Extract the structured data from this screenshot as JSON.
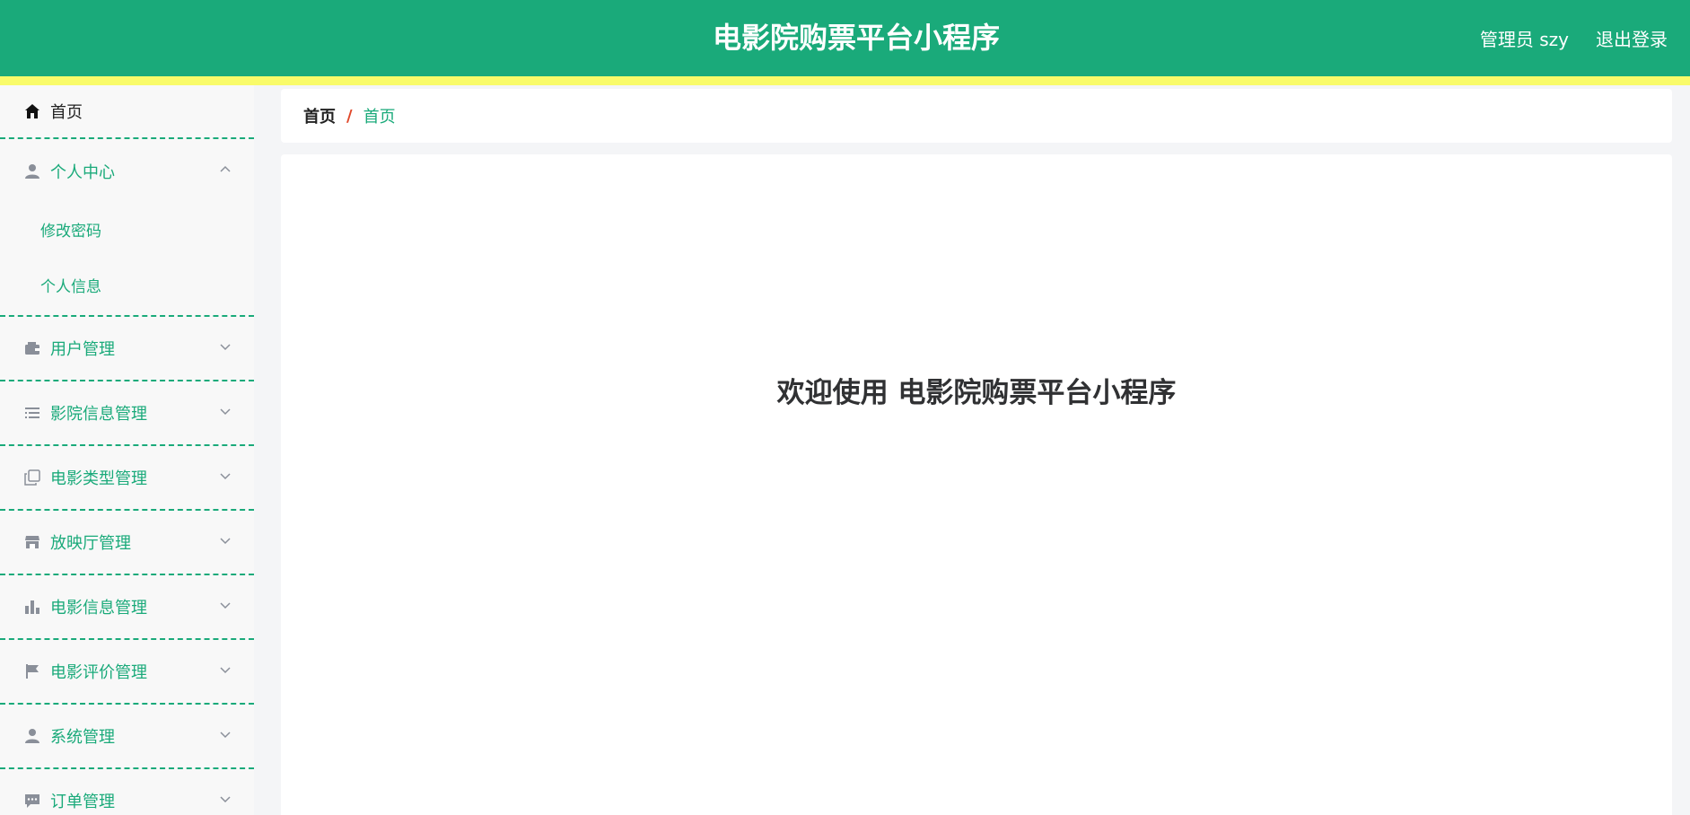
{
  "header": {
    "app_title": "电影院购票平台小程序",
    "user_label": "管理员 szy",
    "logout_label": "退出登录",
    "colors": {
      "primary": "#1aaa7a",
      "stripe": "#f9fb6a"
    }
  },
  "sidebar": {
    "home": {
      "label": "首页",
      "icon": "home-icon"
    },
    "personal": {
      "label": "个人中心",
      "icon": "user-icon",
      "expanded": true,
      "children": [
        "修改密码",
        "个人信息"
      ]
    },
    "items": [
      {
        "label": "用户管理",
        "icon": "wallet-icon"
      },
      {
        "label": "影院信息管理",
        "icon": "list-icon"
      },
      {
        "label": "电影类型管理",
        "icon": "copy-icon"
      },
      {
        "label": "放映厅管理",
        "icon": "shop-icon"
      },
      {
        "label": "电影信息管理",
        "icon": "bar-chart-icon"
      },
      {
        "label": "电影评价管理",
        "icon": "flag-icon"
      },
      {
        "label": "系统管理",
        "icon": "user-icon"
      },
      {
        "label": "订单管理",
        "icon": "message-icon"
      }
    ]
  },
  "breadcrumb": {
    "root": "首页",
    "separator": "/",
    "current": "首页"
  },
  "main": {
    "welcome": "欢迎使用 电影院购票平台小程序"
  }
}
